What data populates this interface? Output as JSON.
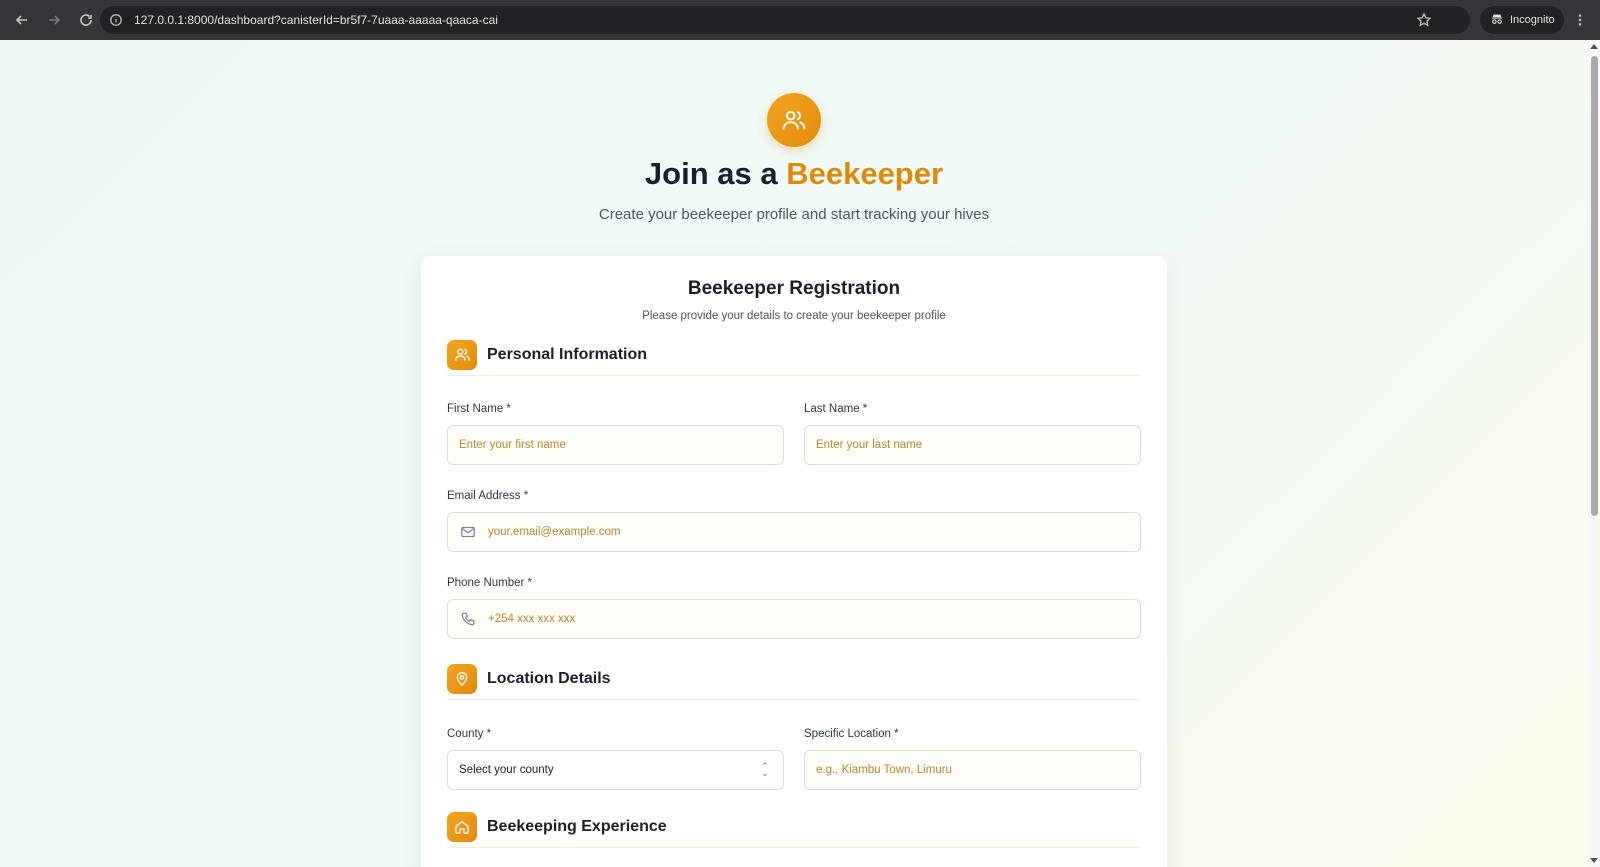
{
  "browser": {
    "url": "127.0.0.1:8000/dashboard?canisterId=br5f7-7uaaa-aaaaa-qaaca-cai",
    "incognito_label": "Incognito"
  },
  "hero": {
    "title_prefix": "Join as a ",
    "title_accent": "Beekeeper",
    "subtitle": "Create your beekeeper profile and start tracking your hives"
  },
  "card": {
    "title": "Beekeeper Registration",
    "subtitle": "Please provide your details to create your beekeeper profile"
  },
  "personal": {
    "heading": "Personal Information",
    "first_name_label": "First Name *",
    "first_name_placeholder": "Enter your first name",
    "last_name_label": "Last Name *",
    "last_name_placeholder": "Enter your last name",
    "email_label": "Email Address *",
    "email_placeholder": "your.email@example.com",
    "phone_label": "Phone Number *",
    "phone_placeholder": "+254 xxx xxx xxx"
  },
  "location": {
    "heading": "Location Details",
    "county_label": "County *",
    "county_value": "Select your county",
    "specific_label": "Specific Location *",
    "specific_placeholder": "e.g., Kiambu Town, Limuru"
  },
  "experience": {
    "heading": "Beekeeping Experience"
  },
  "colors": {
    "accent": "#e08a0b",
    "accent_light": "#f5a623",
    "heading": "#1a1f2e"
  }
}
